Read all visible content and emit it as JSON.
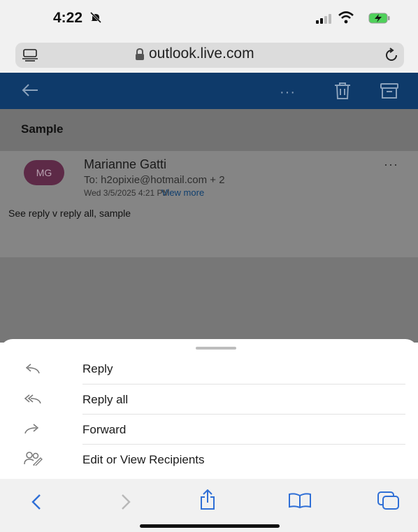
{
  "status_bar": {
    "time": "4:22"
  },
  "browser": {
    "url": "outlook.live.com"
  },
  "email": {
    "subject": "Sample",
    "avatar_initials": "MG",
    "sender": "Marianne Gatti",
    "to": "To: h2opixie@hotmail.com  + 2",
    "date": "Wed 3/5/2025 4:21 PM",
    "view_more": "View more",
    "body": "See reply v reply all, sample"
  },
  "action_sheet": {
    "items": [
      {
        "label": "Reply",
        "icon": "reply-icon"
      },
      {
        "label": "Reply all",
        "icon": "reply-all-icon"
      },
      {
        "label": "Forward",
        "icon": "forward-icon"
      },
      {
        "label": "Edit or View Recipients",
        "icon": "recipients-icon"
      }
    ]
  },
  "colors": {
    "header": "#0e3a6a",
    "avatar": "#5d2a47",
    "link": "#103f6e"
  }
}
